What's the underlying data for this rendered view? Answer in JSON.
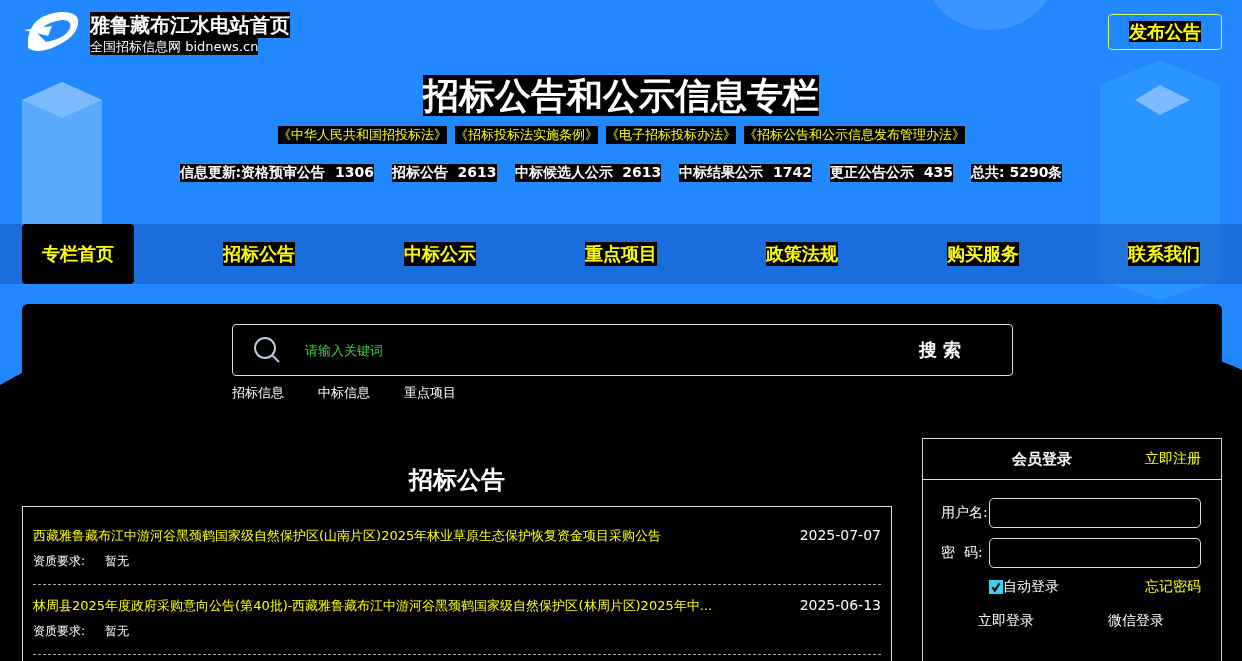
{
  "site": {
    "title": "雅鲁藏布江水电站首页",
    "subtitle": "全国招标信息网 bidnews.cn"
  },
  "publish_button": "发布公告",
  "page_title": "招标公告和公示信息专栏",
  "laws": [
    "《中华人民共和国招投标法》",
    "《招标投标法实施条例》",
    "《电子招标投标办法》",
    "《招标公告和公示信息发布管理办法》"
  ],
  "stats": {
    "prefix": "信息更新:",
    "items": [
      {
        "label": "资格预审公告",
        "count": "1306"
      },
      {
        "label": "招标公告",
        "count": "2613"
      },
      {
        "label": "中标候选人公示",
        "count": "2613"
      },
      {
        "label": "中标结果公示",
        "count": "1742"
      },
      {
        "label": "更正公告公示",
        "count": "435"
      }
    ],
    "total": "总共: 5290条"
  },
  "nav": [
    {
      "label": "专栏首页",
      "selected": true
    },
    {
      "label": "招标公告",
      "selected": false
    },
    {
      "label": "中标公示",
      "selected": false
    },
    {
      "label": "重点项目",
      "selected": false
    },
    {
      "label": "政策法规",
      "selected": false
    },
    {
      "label": "购买服务",
      "selected": false
    },
    {
      "label": "联系我们",
      "selected": false
    }
  ],
  "search": {
    "placeholder": "请输入关键词",
    "button": "搜 索",
    "quick_links": [
      "招标信息",
      "中标信息",
      "重点项目"
    ]
  },
  "list": {
    "title": "招标公告",
    "rows": [
      {
        "title": "西藏雅鲁藏布江中游河谷黑颈鹤国家级自然保护区(山南片区)2025年林业草原生态保护恢复资金项目采购公告",
        "date": "2025-07-07",
        "qual_label": "资质要求:",
        "qual_value": "暂无"
      },
      {
        "title": "林周县2025年度政府采购意向公告(第40批)-西藏雅鲁藏布江中游河谷黑颈鹤国家级自然保护区(林周片区)2025年中...",
        "date": "2025-06-13",
        "qual_label": "资质要求:",
        "qual_value": "暂无"
      }
    ]
  },
  "login": {
    "title": "会员登录",
    "register": "立即注册",
    "username_label": "用户名:",
    "password_label": "密  码:",
    "auto_login": {
      "label": "自动登录",
      "checked": true
    },
    "forgot": "忘记密码",
    "login_button": "立即登录",
    "wechat_button": "微信登录"
  }
}
